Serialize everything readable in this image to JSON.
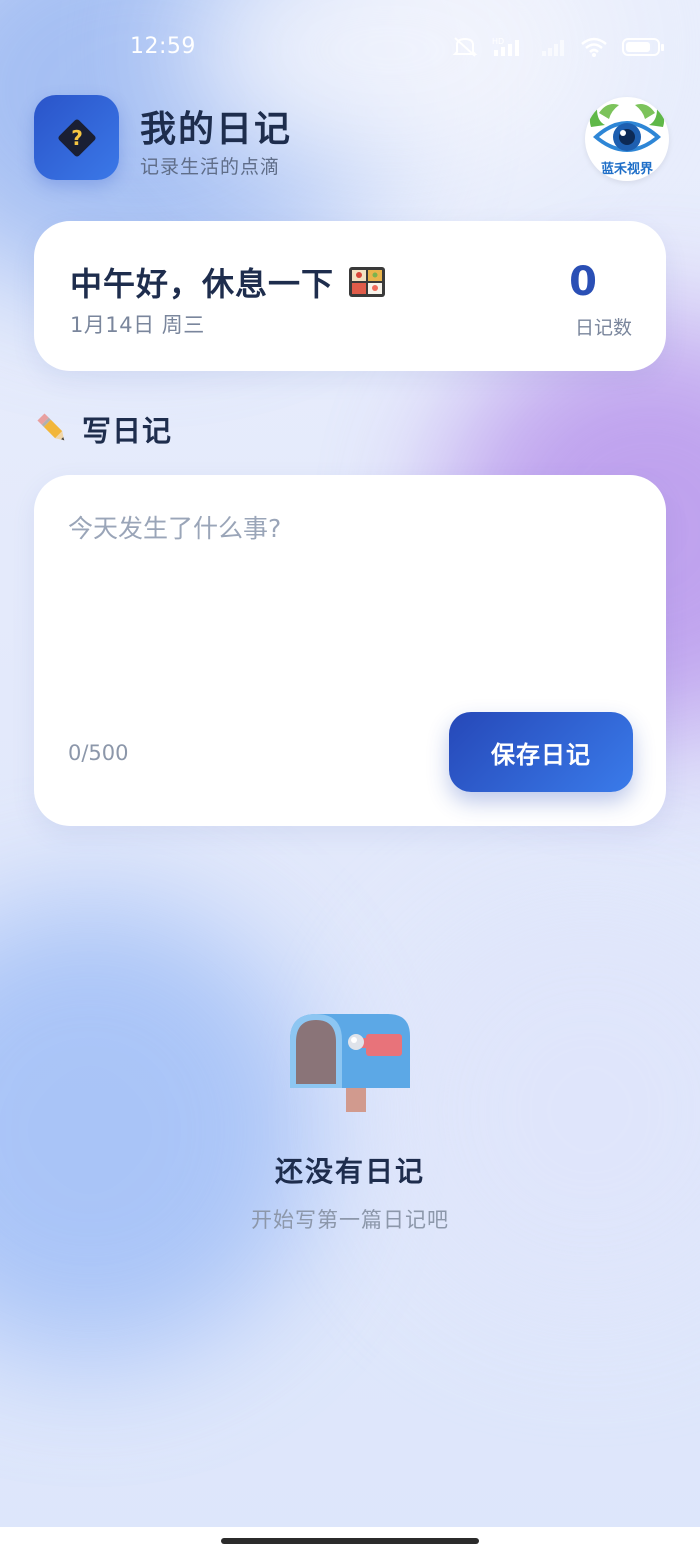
{
  "status_bar": {
    "time": "12:59"
  },
  "header": {
    "title": "我的日记",
    "subtitle": "记录生活的点滴",
    "app_icon": "help-diamond-icon",
    "brand_logo": "eye-logo",
    "brand_logo_text": "蓝禾视界"
  },
  "greeting_card": {
    "greeting": "中午好，休息一下",
    "greeting_emoji": "bento-box-icon",
    "date": "1月14日 周三",
    "diary_count": "0",
    "diary_count_label": "日记数"
  },
  "write_section": {
    "title": "写日记",
    "title_icon": "pencil-icon",
    "placeholder": "今天发生了什么事?",
    "value": "",
    "char_count": "0/500",
    "save_label": "保存日记"
  },
  "empty_state": {
    "icon": "mailbox-icon",
    "title": "还没有日记",
    "subtitle": "开始写第一篇日记吧"
  },
  "colors": {
    "primary": "#2a4fb5",
    "primary_gradient_start": "#2648b8",
    "primary_gradient_end": "#3a7bea",
    "text_dark": "#1e2d4d",
    "text_muted": "#7a869c",
    "card_bg": "#ffffff"
  }
}
